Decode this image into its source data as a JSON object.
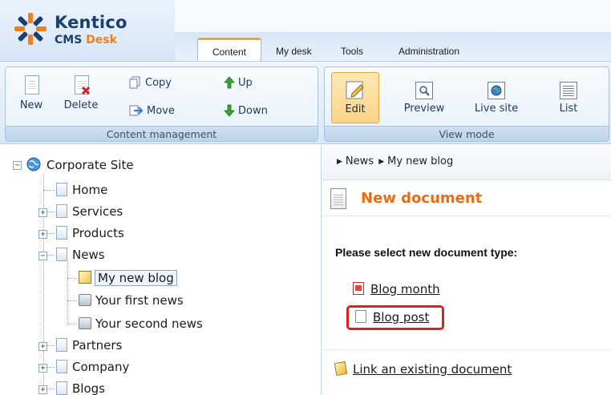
{
  "brand": {
    "name": "Kentico",
    "product_prefix": "CMS",
    "product_accent": "Desk"
  },
  "tabs": [
    {
      "label": "Content",
      "active": true
    },
    {
      "label": "My desk"
    },
    {
      "label": "Tools"
    },
    {
      "label": "Administration"
    }
  ],
  "toolbar": {
    "content_management": {
      "caption": "Content management",
      "new_label": "New",
      "delete_label": "Delete",
      "copy_label": "Copy",
      "move_label": "Move",
      "up_label": "Up",
      "down_label": "Down"
    },
    "view_mode": {
      "caption": "View mode",
      "edit_label": "Edit",
      "preview_label": "Preview",
      "live_site_label": "Live site",
      "list_label": "List"
    }
  },
  "tree": {
    "root": "Corporate Site",
    "items": [
      {
        "label": "Home"
      },
      {
        "label": "Services"
      },
      {
        "label": "Products"
      },
      {
        "label": "News"
      },
      {
        "label": "My new blog"
      },
      {
        "label": "Your first news"
      },
      {
        "label": "Your second news"
      },
      {
        "label": "Partners"
      },
      {
        "label": "Company"
      },
      {
        "label": "Blogs"
      }
    ]
  },
  "breadcrumb": {
    "items": [
      "News",
      "My new blog"
    ]
  },
  "main": {
    "title": "New document",
    "prompt": "Please select new document type:",
    "types": [
      "Blog month",
      "Blog post"
    ],
    "link_existing": "Link an existing document"
  },
  "colors": {
    "accent_orange": "#e96b12",
    "highlight_red": "#e02020",
    "brand_navy": "#1c3f6d"
  }
}
